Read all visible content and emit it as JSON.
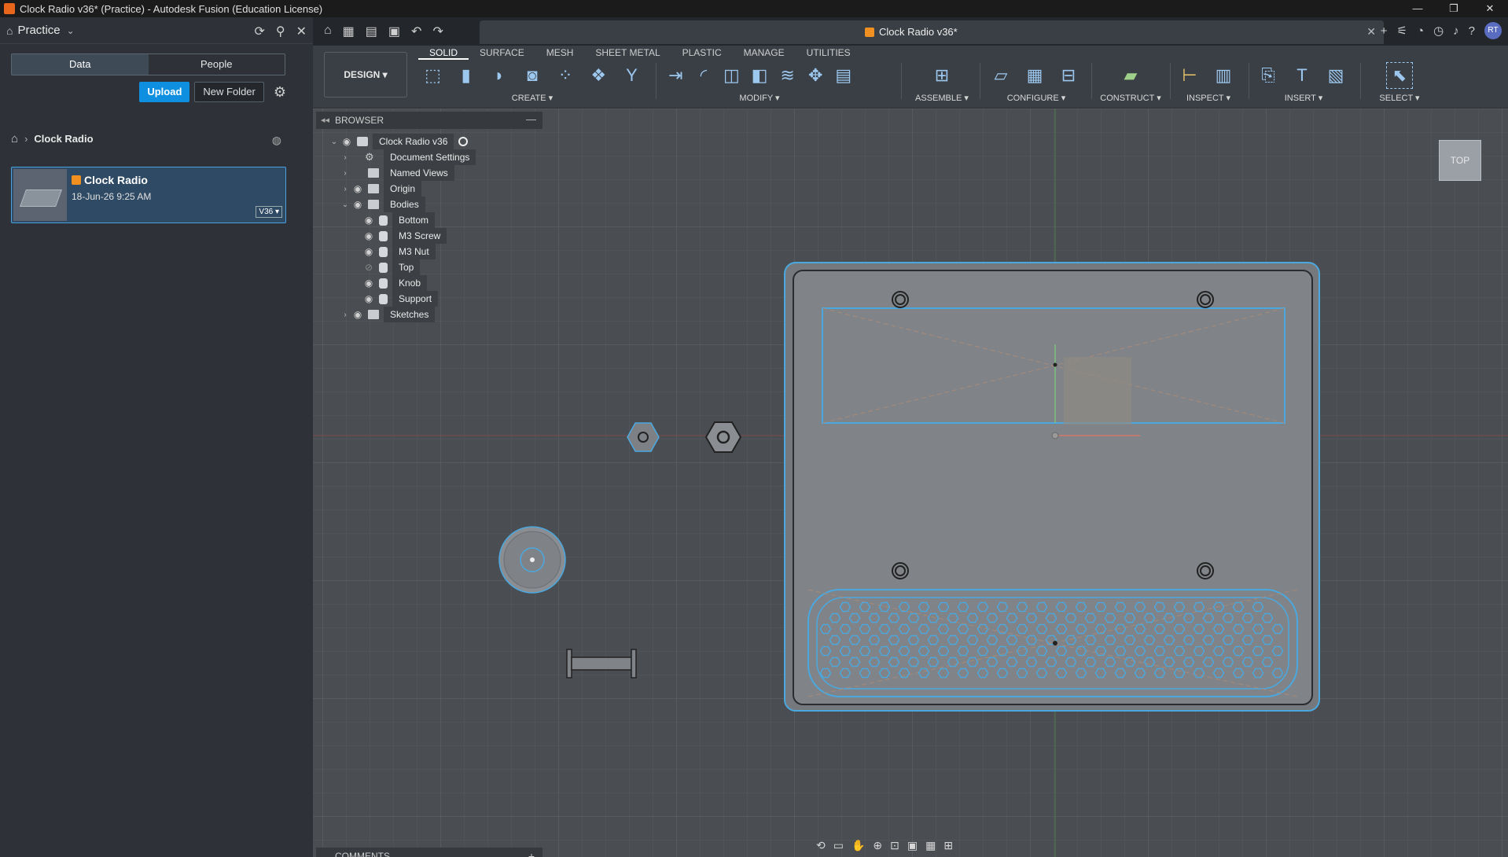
{
  "window": {
    "title": "Clock Radio v36* (Practice) - Autodesk Fusion (Education License)",
    "controls": [
      "—",
      "❐",
      "✕"
    ]
  },
  "data_panel": {
    "project": "Practice",
    "tabs": [
      "Data",
      "People"
    ],
    "active_tab": "Data",
    "upload_label": "Upload",
    "new_folder_label": "New Folder",
    "breadcrumb": "Clock Radio",
    "file": {
      "name": "Clock Radio",
      "date": "18-Jun-26 9:25 AM",
      "version": "V36 ▾"
    }
  },
  "header": {
    "doc_tab": "Clock Radio v36*",
    "user_initials": "RT"
  },
  "toolbar": {
    "design_label": "DESIGN ▾",
    "workspace_tabs": [
      "SOLID",
      "SURFACE",
      "MESH",
      "SHEET METAL",
      "PLASTIC",
      "MANAGE",
      "UTILITIES"
    ],
    "active_workspace": "SOLID",
    "groups": {
      "create": "CREATE ▾",
      "modify": "MODIFY ▾",
      "assemble": "ASSEMBLE ▾",
      "configure": "CONFIGURE ▾",
      "construct": "CONSTRUCT ▾",
      "inspect": "INSPECT ▾",
      "insert": "INSERT ▾",
      "select": "SELECT ▾"
    }
  },
  "browser": {
    "title": "BROWSER",
    "root": "Clock Radio v36",
    "items": [
      {
        "label": "Document Settings"
      },
      {
        "label": "Named Views"
      },
      {
        "label": "Origin"
      },
      {
        "label": "Bodies"
      },
      {
        "label": "Bottom"
      },
      {
        "label": "M3 Screw"
      },
      {
        "label": "M3 Nut"
      },
      {
        "label": "Top"
      },
      {
        "label": "Knob"
      },
      {
        "label": "Support"
      },
      {
        "label": "Sketches"
      }
    ]
  },
  "comments": {
    "title": "COMMENTS"
  },
  "viewcube": {
    "face": "TOP"
  },
  "colors": {
    "accent": "#0e8fe0",
    "viewport_bg": "#4a4d51",
    "selection": "#4aa8e0"
  }
}
